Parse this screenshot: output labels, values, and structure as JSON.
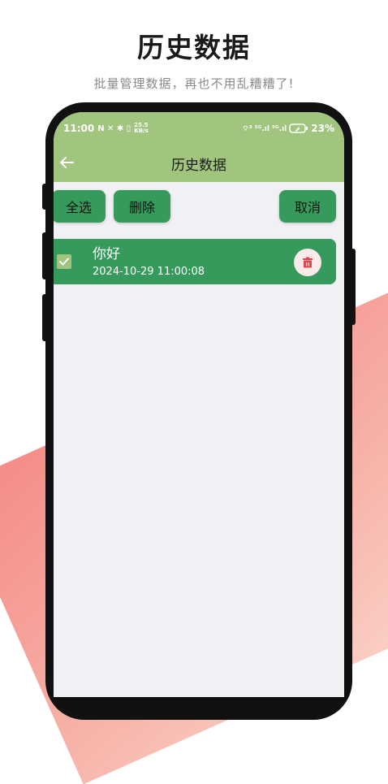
{
  "hero": {
    "title": "历史数据",
    "subtitle": "批量管理数据，再也不用乱糟糟了!"
  },
  "statusbar": {
    "time": "11:00",
    "left_icons": "N ✕ ✱ ▯",
    "speed_top": "25.5",
    "speed_bottom": "KB/s",
    "signal_text": "⌔³ ⁵ᴳ.ıl ⁵ᴳ.ıl",
    "battery": "23%"
  },
  "appbar": {
    "title": "历史数据",
    "back_icon": "arrow-left-icon"
  },
  "toolbar": {
    "select_all_label": "全选",
    "delete_label": "删除",
    "cancel_label": "取消"
  },
  "records": [
    {
      "title": "你好",
      "time": "2024-10-29 11:00:08",
      "checked": true
    }
  ],
  "colors": {
    "header_green": "#a1c47f",
    "button_green": "#359a5b",
    "background": "#f1f0f4",
    "delete_red": "#e0454b",
    "wave_coral": "#f48a86"
  }
}
